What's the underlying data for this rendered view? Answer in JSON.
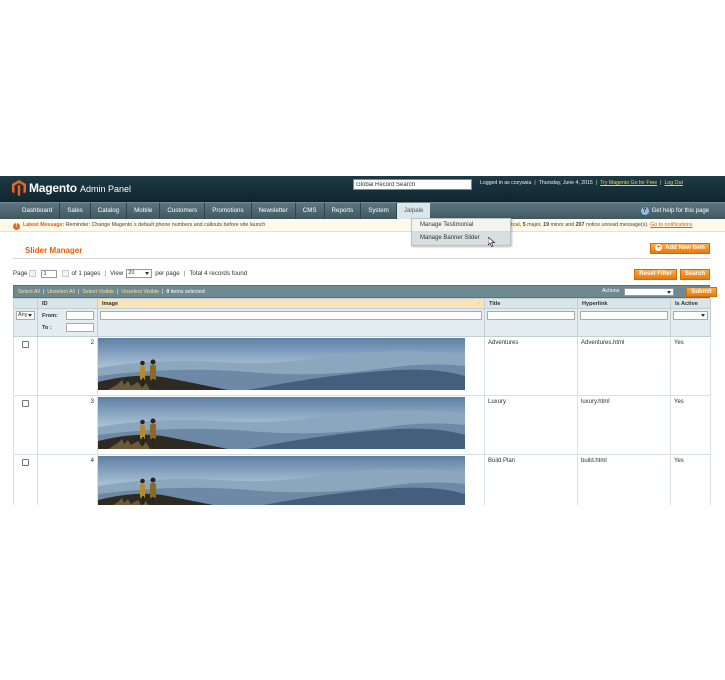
{
  "header": {
    "brand": "Magento",
    "panel": "Admin Panel",
    "search_placeholder": "Global Record Search",
    "logged_in": "Logged in as cozyasia",
    "date": "Thursday, June 4, 2015",
    "try_link": "Try Magento Go for Free",
    "logout": "Log Out"
  },
  "nav": {
    "items": [
      "Dashboard",
      "Sales",
      "Catalog",
      "Mobile",
      "Customers",
      "Promotions",
      "Newsletter",
      "CMS",
      "Reports",
      "System",
      "Jalpale"
    ],
    "help": "Get help for this page"
  },
  "dropdown": [
    "Manage Testimonial",
    "Manage Banner Slider"
  ],
  "notice": {
    "label": "Latest Message:",
    "text": "Reminder: Change Magento`s default phone numbers and callouts before site launch",
    "right_prefix": "ical,",
    "major_count": "5",
    "major_text": "major,",
    "minor_count": "19",
    "minor_text": "minor and",
    "unread_count": "207",
    "unread_text": "notice unread message(s).",
    "goto": "Go to notifications"
  },
  "page": {
    "title": "Slider Manager",
    "add_button": "Add New Item",
    "reset_button": "Reset Filter",
    "search_button": "Search"
  },
  "pager": {
    "page_label": "Page",
    "page_value": "1",
    "of_pages": "of 1 pages",
    "view_label": "View",
    "per_page_value": "20",
    "per_page": "per page",
    "total": "Total 4 records found"
  },
  "mass": {
    "select_all": "Select All",
    "unselect_all": "Unselect All",
    "select_visible": "Select Visible",
    "unselect_visible": "Unselect Visible",
    "selected_count": "0",
    "selected_text": "items selected",
    "actions_label": "Actions",
    "submit": "Submit"
  },
  "grid": {
    "columns": [
      "ID",
      "Image",
      "Title",
      "Hyperlink",
      "Is Active"
    ],
    "filter": {
      "any": "Any",
      "from": "From:",
      "to": "To :"
    },
    "rows": [
      {
        "id": "2",
        "title": "Adventures",
        "link": "Adventures.html",
        "active": "Yes"
      },
      {
        "id": "3",
        "title": "Luxury",
        "link": "luxury.html",
        "active": "Yes"
      },
      {
        "id": "4",
        "title": "Build Plan",
        "link": "build.html",
        "active": "Yes"
      }
    ]
  },
  "colors": {
    "accent": "#eb5e00",
    "header": "#1e3a44",
    "nav": "#50686f",
    "gridhead": "#d9e5e8"
  }
}
